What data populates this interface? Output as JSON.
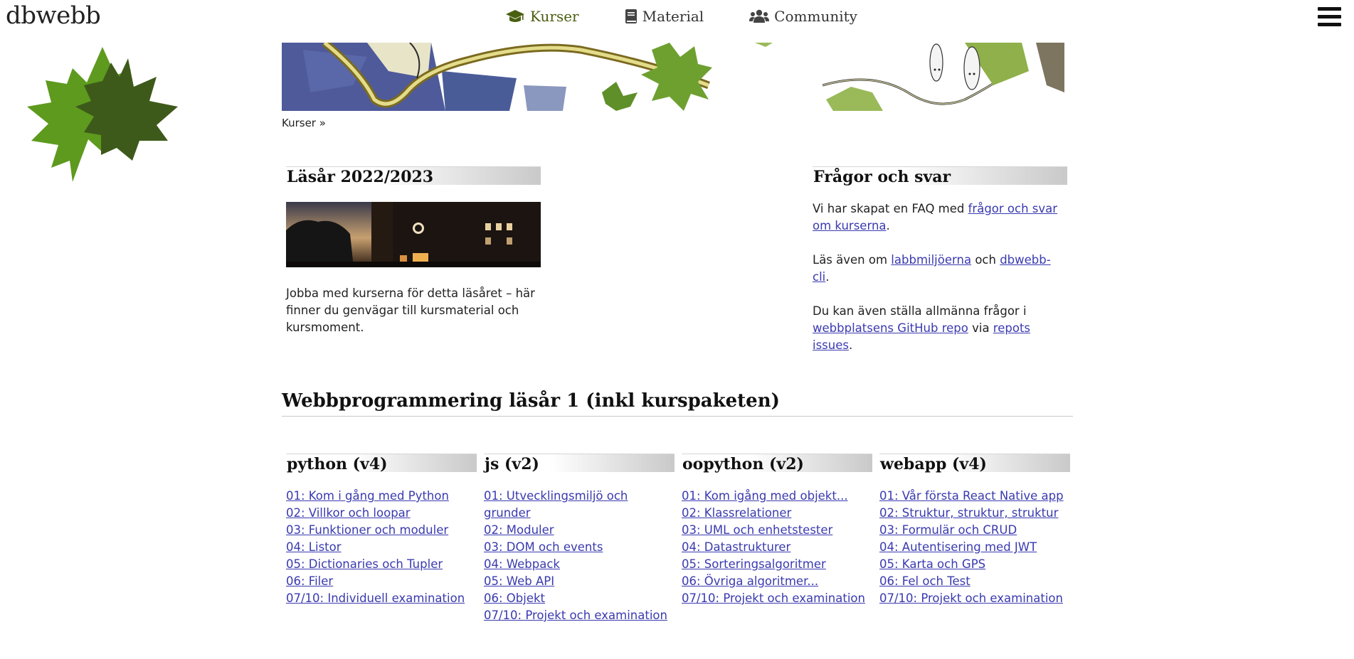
{
  "site": {
    "logo": "dbwebb"
  },
  "nav": {
    "items": [
      {
        "label": "Kurser",
        "icon": "graduation-cap-icon",
        "active": true
      },
      {
        "label": "Material",
        "icon": "book-icon",
        "active": false
      },
      {
        "label": "Community",
        "icon": "users-icon",
        "active": false
      }
    ],
    "active_color": "#4a5f10"
  },
  "breadcrumb": {
    "label": "Kurser",
    "sep": "»"
  },
  "year": {
    "title": "Läsår 2022/2023",
    "text": "Jobba med kurserna för detta läsåret – här finner du genvägar till kursmaterial och kursmoment."
  },
  "faq": {
    "title": "Frågor och svar",
    "p1": {
      "pre": "Vi har skapat en FAQ med ",
      "link": "frågor och svar om kurserna",
      "post": "."
    },
    "p2": {
      "pre": "Läs även om ",
      "link1": "labbmiljöerna",
      "mid": " och ",
      "link2": "dbwebb-cli",
      "post": "."
    },
    "p3": {
      "pre": "Du kan även ställa allmänna frågor i ",
      "link1": "webbplatsens GitHub repo",
      "mid": " via ",
      "link2": "repots issues",
      "post": "."
    }
  },
  "section": {
    "heading": "Webbprogrammering läsår 1 (inkl kurspaketen)"
  },
  "courses": [
    {
      "title": "python (v4)",
      "items": [
        "01: Kom i gång med Python",
        "02: Villkor och loopar",
        "03: Funktioner och moduler",
        "04: Listor",
        "05: Dictionaries och Tupler",
        "06: Filer",
        "07/10: Individuell examination"
      ]
    },
    {
      "title": "js (v2)",
      "items": [
        "01: Utvecklingsmiljö och grunder",
        "02: Moduler",
        "03: DOM och events",
        "04: Webpack",
        "05: Web API",
        "06: Objekt",
        "07/10: Projekt och examination"
      ]
    },
    {
      "title": "oopython (v2)",
      "items": [
        "01: Kom igång med objekt...",
        "02: Klassrelationer",
        "03: UML och enhetstester",
        "04: Datastrukturer",
        "05: Sorteringsalgoritmer",
        "06: Övriga algoritmer...",
        "07/10: Projekt och examination"
      ]
    },
    {
      "title": "webapp (v4)",
      "items": [
        "01: Vår första React Native app",
        "02: Struktur, struktur, struktur",
        "03: Formulär och CRUD",
        "04: Autentisering med JWT",
        "05: Karta och GPS",
        "06: Fel och Test",
        "07/10: Projekt och examination"
      ]
    }
  ],
  "colors": {
    "link": "#3a3ab0",
    "leaf_light": "#5d9a1e",
    "leaf_dark": "#3e5a1a"
  }
}
